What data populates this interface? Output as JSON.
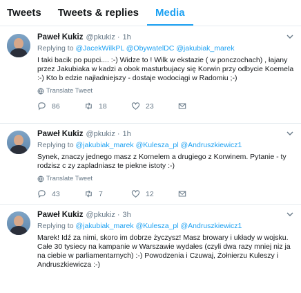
{
  "tabs": [
    {
      "label": "Tweets",
      "active": false
    },
    {
      "label": "Tweets & replies",
      "active": false
    },
    {
      "label": "Media",
      "active": true
    }
  ],
  "colors": {
    "accent": "#1da1f2",
    "muted": "#657786",
    "text": "#14171a",
    "border": "#e6ecf0"
  },
  "tweets": [
    {
      "name": "Paweł Kukiz",
      "handle": "@pkukiz",
      "dot": "·",
      "time": "1h",
      "reply_prefix": "Replying to",
      "reply_mentions": "@JacekWilkPL @ObywatelDC @jakubiak_marek",
      "text": "I taki bacik po pupci.... :-) Widze to ! Wilk w ekstazie ( w ponczochach) , łajany przez Jakubiaka w kadzi a obok masturbujacy się Korwin przy odbycie Koemela :-) Kto b edzie najładniejszy - dostaje wodociągi w Radomiu ;-)",
      "translate": "Translate Tweet",
      "replies": "86",
      "retweets": "18",
      "likes": "23"
    },
    {
      "name": "Paweł Kukiz",
      "handle": "@pkukiz",
      "dot": "·",
      "time": "1h",
      "reply_prefix": "Replying to",
      "reply_mentions": "@jakubiak_marek @Kulesza_pl @Andruszkiewicz1",
      "text": "Synek, znaczy jednego masz z Kornelem a drugiego z Korwinem. Pytanie - ty rodzisz c zy zapladniasz te piekne istoty :-)",
      "translate": "Translate Tweet",
      "replies": "43",
      "retweets": "7",
      "likes": "12"
    },
    {
      "name": "Paweł Kukiz",
      "handle": "@pkukiz",
      "dot": "·",
      "time": "3h",
      "reply_prefix": "Replying to",
      "reply_mentions": "@jakubiak_marek @Kulesza_pl @Andruszkiewicz1",
      "text": "Marek! Idź za nimi, skoro im dobrze życzysz! Masz browary i układy w wojsku. Całe 30 tysiecy na kampanie w Warszawie wydałes (czyli dwa razy mniej niz ja na ciebie w parliamentarnych) :-) Powodzenia i Czuwaj, Żołnierzu Kuleszy i Andruszkiewicza :-)"
    }
  ]
}
